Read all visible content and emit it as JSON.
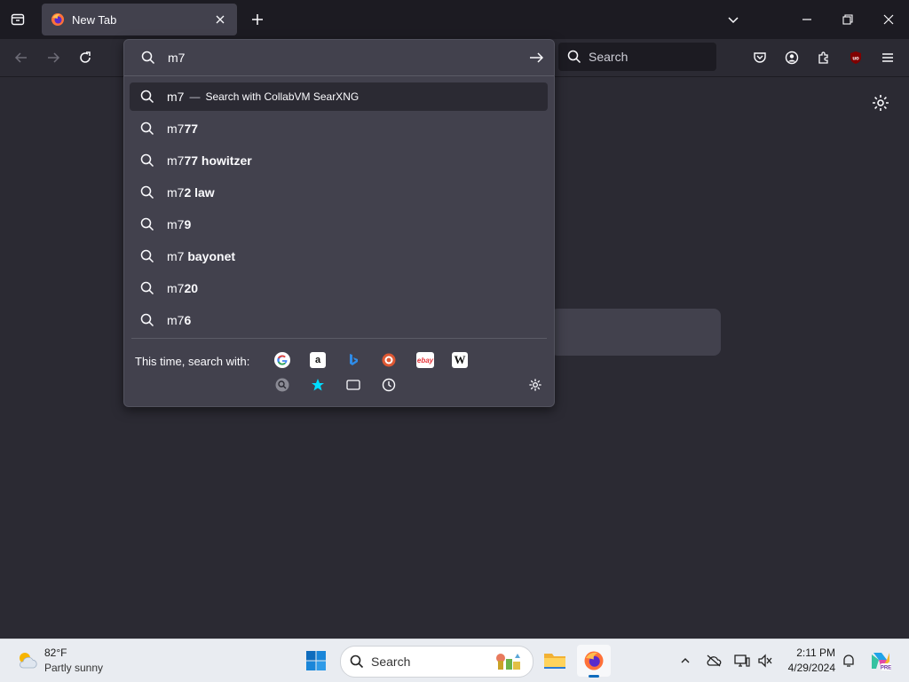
{
  "tab": {
    "title": "New Tab",
    "close": "×"
  },
  "toolbar": {
    "search_placeholder": "Search",
    "new_tab": "+"
  },
  "urlbar": {
    "typed": "m7",
    "top_suggestion": {
      "text": "m7",
      "dash": "—",
      "action": "Search with CollabVM SearXNG"
    },
    "suggestions": [
      {
        "prefix": "m7",
        "completion": "77"
      },
      {
        "prefix": "m7",
        "completion": "77 howitzer"
      },
      {
        "prefix": "m7",
        "completion": "2 law"
      },
      {
        "prefix": "m7",
        "completion": "9"
      },
      {
        "prefix": "m7",
        "completion": " bayonet"
      },
      {
        "prefix": "m7",
        "completion": "20"
      },
      {
        "prefix": "m7",
        "completion": "6"
      }
    ],
    "one_off_label": "This time, search with:",
    "engines": [
      "google-icon",
      "amazon-icon",
      "bing-icon",
      "duckduckgo-icon",
      "ebay-icon",
      "wikipedia-icon",
      "searxng-icon",
      "bookmarks-icon",
      "tabs-icon",
      "history-icon"
    ],
    "engine_glyphs": {
      "wikipedia": "W",
      "ebay": "ebay",
      "amazon": "a"
    }
  },
  "taskbar": {
    "weather_temp": "82°F",
    "weather_condition": "Partly sunny",
    "search_label": "Search",
    "time": "2:11 PM",
    "date": "4/29/2024"
  },
  "colors": {
    "accent_firefox": "#ff7139",
    "panel": "#42414d",
    "background": "#2b2a33"
  }
}
